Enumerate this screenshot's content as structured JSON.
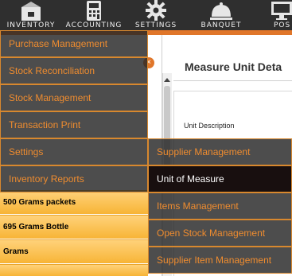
{
  "nav": {
    "items": [
      {
        "label": "INVENTORY",
        "icon": "inventory-box-icon"
      },
      {
        "label": "ACCOUNTING",
        "icon": "calculator-icon"
      },
      {
        "label": "SETTINGS",
        "icon": "gear-icon"
      },
      {
        "label": "BANQUET",
        "icon": "cloche-icon"
      },
      {
        "label": "POS",
        "icon": "monitor-icon"
      }
    ]
  },
  "inventory_menu": {
    "items": [
      "Purchase Management",
      "Stock Reconciliation",
      "Stock Management",
      "Transaction Print",
      "Settings",
      "Inventory Reports"
    ]
  },
  "settings_submenu": {
    "items": [
      "Supplier Management",
      "Unit of Measure",
      "Items Management",
      "Open Stock Management",
      "Supplier Item Management"
    ],
    "active_item": "Unit of Measure"
  },
  "unit_list": {
    "rows": [
      "500 Grams packets",
      "695 Grams Bottle",
      "Grams"
    ]
  },
  "detail": {
    "title": "Measure Unit Deta",
    "unit_description_label": "Unit Description"
  },
  "colors": {
    "nav_bg": "#2f2f2f",
    "accent_orange": "#e0762a",
    "menu_text": "#ef8c2f",
    "row_gold": "#f7b436"
  }
}
